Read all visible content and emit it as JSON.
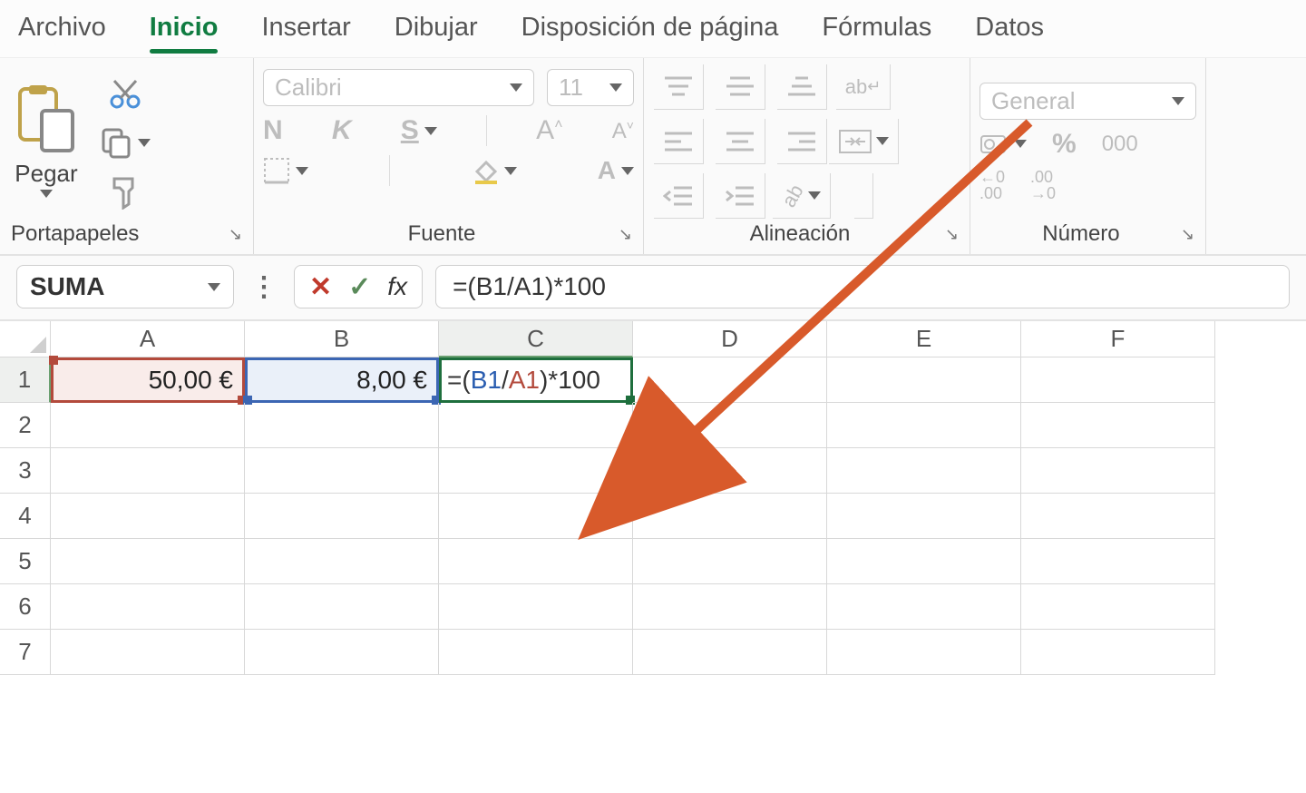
{
  "tabs": {
    "items": [
      "Archivo",
      "Inicio",
      "Insertar",
      "Dibujar",
      "Disposición de página",
      "Fórmulas",
      "Datos"
    ],
    "active_index": 1
  },
  "ribbon": {
    "clipboard": {
      "paste_label": "Pegar",
      "group_label": "Portapapeles"
    },
    "font": {
      "name": "Calibri",
      "size": "11",
      "bold_letter": "N",
      "italic_letter": "K",
      "underline_letter": "S",
      "bigA": "A",
      "group_label": "Fuente"
    },
    "alignment": {
      "group_label": "Alineación",
      "wrap_glyph": "ab"
    },
    "number": {
      "format_name": "General",
      "percent_glyph": "%",
      "thousands_glyph": "000",
      "inc_dec_a": "←0\n.00",
      "inc_dec_b": ".00\n→0",
      "group_label": "Número"
    }
  },
  "fxbar": {
    "namebox": "SUMA",
    "formula": "=(B1/A1)*100",
    "fx_glyph": "fx"
  },
  "grid": {
    "columns": [
      "A",
      "B",
      "C",
      "D",
      "E",
      "F"
    ],
    "active_column_index": 2,
    "rows": [
      1,
      2,
      3,
      4,
      5,
      6,
      7
    ],
    "active_row_index": 0,
    "cells": {
      "A1": "50,00 €",
      "B1": "8,00 €",
      "C1_parts": {
        "p1": "=(",
        "p2": "B1",
        "p3": "/",
        "p4": "A1",
        "p5": ")*100"
      }
    }
  },
  "colors": {
    "ref_a": "#b34a3c",
    "ref_b": "#3c66b3",
    "active_cell": "#1e6f3d",
    "arrow": "#d85a2b"
  }
}
